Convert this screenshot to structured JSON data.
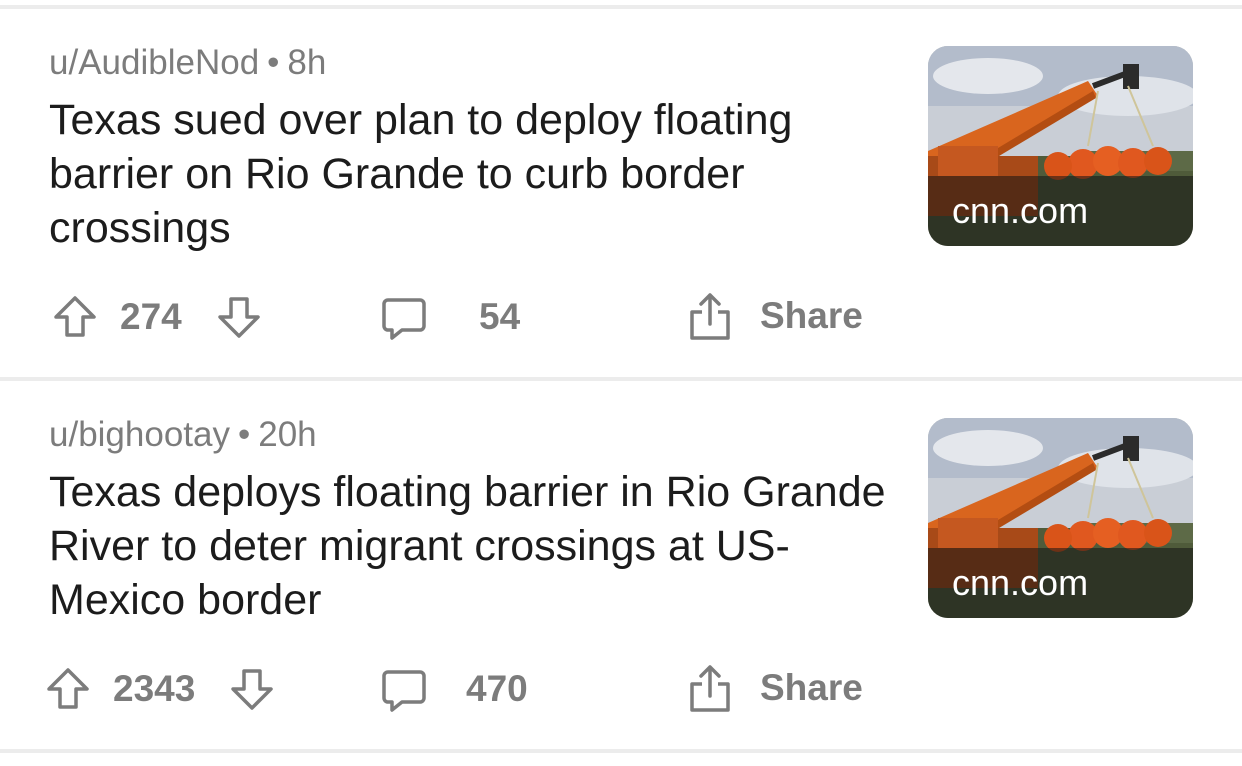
{
  "posts": [
    {
      "author": "u/AudibleNod",
      "separator": "•",
      "age": "8h",
      "title": "Texas sued over plan to deploy floating barrier on Rio Grande to curb border crossings",
      "thumbnail_caption": "cnn.com",
      "score": "274",
      "comments": "54",
      "share_label": "Share"
    },
    {
      "author": "u/bighootay",
      "separator": "•",
      "age": "20h",
      "title": "Texas deploys floating barrier in Rio Grande River to deter migrant crossings at US-Mexico border",
      "thumbnail_caption": "cnn.com",
      "score": "2343",
      "comments": "470",
      "share_label": "Share"
    }
  ],
  "icons": {
    "upvote": "arrow-up-icon",
    "downvote": "arrow-down-icon",
    "comment": "speech-bubble-icon",
    "share": "share-icon"
  },
  "colors": {
    "meta_text": "#7c7c7c",
    "title_text": "#1c1c1c",
    "divider": "#ececec",
    "background": "#ffffff"
  }
}
